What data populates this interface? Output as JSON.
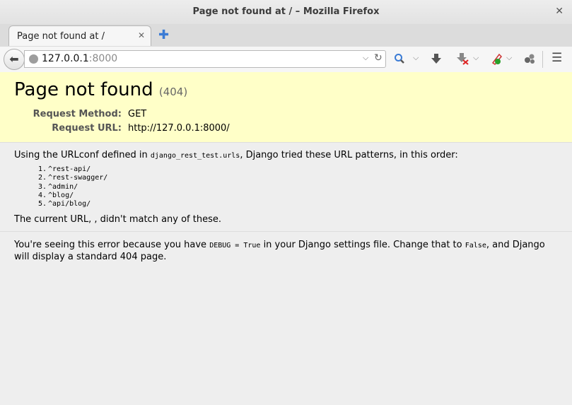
{
  "window": {
    "title": "Page not found at / – Mozilla Firefox",
    "close_glyph": "✕"
  },
  "tabs": [
    {
      "label": "Page not found at /",
      "close_glyph": "✕"
    }
  ],
  "new_tab_glyph": "✚",
  "navbar": {
    "back_glyph": "⬅",
    "url_host": "127.0.0.1",
    "url_port": ":8000",
    "dropdown_glyph": "⌵",
    "reload_glyph": "↻",
    "search_icon_glyph": "🔍",
    "download_glyph": "⬇",
    "chevron_glyph": "⌵",
    "menu_glyph": "☰",
    "icons": [
      "back-icon",
      "globe-icon",
      "dropdown-icon",
      "reload-icon",
      "search-icon",
      "download-icon",
      "blocked-download-icon",
      "plugin-icon",
      "extension-icon",
      "hamburger-menu-icon"
    ]
  },
  "page": {
    "title": "Page not found",
    "status_code": "(404)",
    "request_method_label": "Request Method:",
    "request_method": "GET",
    "request_url_label": "Request URL:",
    "request_url": "http://127.0.0.1:8000/",
    "urlconf_prefix": "Using the URLconf defined in ",
    "urlconf_module": "django_rest_test.urls",
    "urlconf_suffix": ", Django tried these URL patterns, in this order:",
    "patterns": [
      {
        "num": "1.",
        "pattern": "^rest-api/"
      },
      {
        "num": "2.",
        "pattern": "^rest-swagger/"
      },
      {
        "num": "3.",
        "pattern": "^admin/"
      },
      {
        "num": "4.",
        "pattern": "^blog/"
      },
      {
        "num": "5.",
        "pattern": "^api/blog/"
      }
    ],
    "no_match": "The current URL, , didn't match any of these.",
    "explain_1": "You're seeing this error because you have ",
    "explain_code_1": "DEBUG = True",
    "explain_2": " in your Django settings file. Change that to ",
    "explain_code_2": "False",
    "explain_3": ", and Django will display a standard 404 page."
  },
  "colors": {
    "summary_bg": "#ffffc8",
    "accent_blue": "#3a7bd5",
    "content_bg": "#eeeeee"
  }
}
